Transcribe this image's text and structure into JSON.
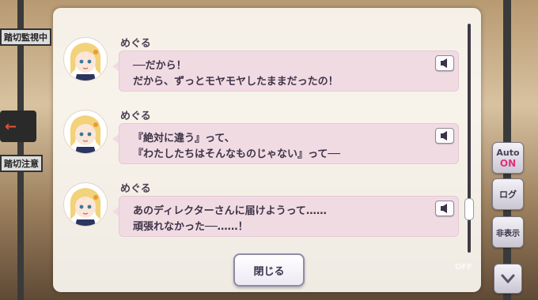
{
  "background": {
    "sign_top": "踏切監視中",
    "sign_bottom": "踏切注意"
  },
  "log": {
    "entries": [
      {
        "speaker": "めぐる",
        "line1": "──だから！",
        "line2": "だから、ずっとモヤモヤしたままだったの！"
      },
      {
        "speaker": "めぐる",
        "line1": "『絶対に違う』って、",
        "line2": "『わたしたちはそんなものじゃない』って──"
      },
      {
        "speaker": "めぐる",
        "line1": "あのディレクターさんに届けようって……",
        "line2": "頑張れなかった──……！"
      }
    ],
    "close_label": "閉じる"
  },
  "sidebar": {
    "auto_label": "Auto",
    "auto_state": "ON",
    "log_label": "ログ",
    "hide_label": "非表示",
    "skip_label_state": "OFF"
  },
  "icons": {
    "voice": "speaker-icon",
    "down": "chevron-down-icon"
  },
  "colors": {
    "bubble": "#f1dbe3",
    "auto_on": "#e0307a"
  }
}
